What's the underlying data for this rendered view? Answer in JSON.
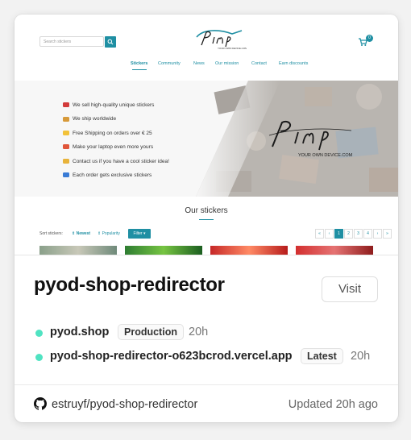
{
  "preview": {
    "search_placeholder": "Search stickers",
    "cart_count": "0",
    "logo_text": "Pimp",
    "logo_sub": "YOUR OWN DEVICE.COM",
    "nav": [
      "Stickers",
      "Community",
      "News",
      "Our mission",
      "Contact",
      "Earn discounts"
    ],
    "banner_lines": [
      "We sell high-quality unique stickers",
      "We ship worldwide",
      "Free Shipping on orders over € 25",
      "Make your laptop even more yours",
      "Contact us if you have a cool sticker idea!",
      "Each order gets exclusive stickers"
    ],
    "section_title": "Our stickers",
    "sort_label": "Sort stickers:",
    "sort_newest": "⇕ Newest",
    "sort_popularity": "⇕ Popularity",
    "filter_label": "Filter ▾",
    "pager": [
      "«",
      "‹",
      "1",
      "2",
      "3",
      "4",
      "›",
      "»"
    ]
  },
  "project": {
    "name": "pyod-shop-redirector",
    "visit_label": "Visit"
  },
  "deployments": [
    {
      "domain": "pyod.shop",
      "badge": "Production",
      "age": "20h"
    },
    {
      "domain": "pyod-shop-redirector-o623bcrod.vercel.app",
      "badge": "Latest",
      "age": "20h"
    }
  ],
  "footer": {
    "repo": "estruyf/pyod-shop-redirector",
    "updated": "Updated 20h ago"
  },
  "colors": {
    "accent": "#1f8fa3",
    "status_ready": "#50e3c2"
  }
}
